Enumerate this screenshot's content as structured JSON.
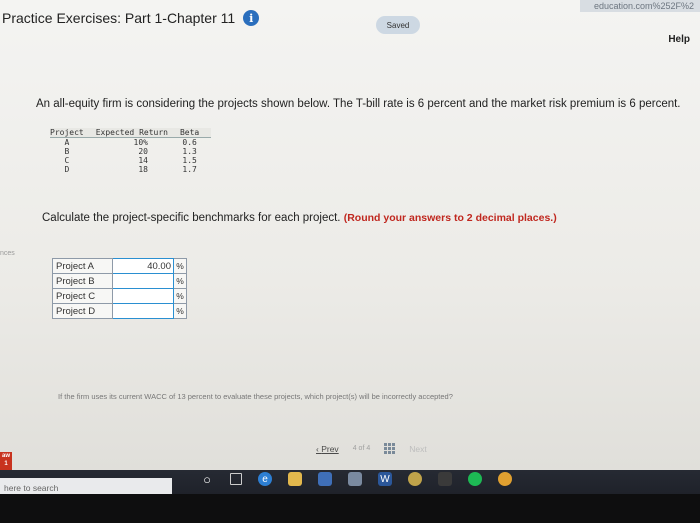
{
  "browser": {
    "url_fragment": "education.com%252F%2"
  },
  "header": {
    "title": "Practice Exercises: Part 1-Chapter 11",
    "saved_label": "Saved",
    "help_label": "Help"
  },
  "question": {
    "intro": "An all-equity firm is considering the projects shown below. The T-bill rate is 6 percent and the market risk premium is 6 percent.",
    "table": {
      "headers": [
        "Project",
        "Expected Return",
        "Beta"
      ],
      "rows": [
        [
          "A",
          "10%",
          "0.6"
        ],
        [
          "B",
          "20",
          "1.3"
        ],
        [
          "C",
          "14",
          "1.5"
        ],
        [
          "D",
          "18",
          "1.7"
        ]
      ]
    },
    "calc_prompt": "Calculate the project-specific benchmarks for each project.",
    "calc_note": "(Round your answers to 2 decimal places.)",
    "answers": [
      {
        "label": "Project A",
        "value": "40.00",
        "unit": "%"
      },
      {
        "label": "Project B",
        "value": "",
        "unit": "%"
      },
      {
        "label": "Project C",
        "value": "",
        "unit": "%"
      },
      {
        "label": "Project D",
        "value": "",
        "unit": "%"
      }
    ],
    "wacc_question": "If the firm uses its current WACC of 13 percent to evaluate these projects, which project(s) will be incorrectly accepted?"
  },
  "side": {
    "fragment": "nces"
  },
  "nav": {
    "prev": "Prev",
    "page_current": "4",
    "page_of": "of",
    "page_total": "4",
    "next": "Next"
  },
  "badge": {
    "line1": "aw",
    "line2": "1"
  },
  "taskbar": {
    "search_placeholder": "here to search"
  }
}
